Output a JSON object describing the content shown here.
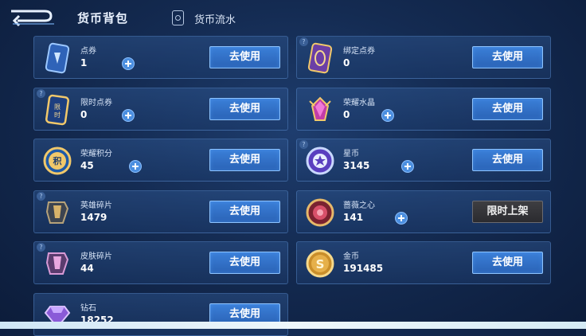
{
  "header": {
    "title": "货币背包",
    "flow_label": "货币流水",
    "back_icon": "back-arrow-icon",
    "flow_icon": "ledger-icon"
  },
  "action_label": "去使用",
  "limited_label": "限时上架",
  "items": [
    {
      "name": "点券",
      "count": "1",
      "icon": "coupon-icon",
      "help": false,
      "plus": true,
      "action": "use"
    },
    {
      "name": "绑定点券",
      "count": "0",
      "icon": "bound-coupon-icon",
      "help": true,
      "plus": false,
      "action": "use"
    },
    {
      "name": "限时点券",
      "count": "0",
      "icon": "limited-coupon-icon",
      "help": true,
      "plus": true,
      "action": "use"
    },
    {
      "name": "荣耀水晶",
      "count": "0",
      "icon": "glory-crystal-icon",
      "help": false,
      "plus": true,
      "action": "use"
    },
    {
      "name": "荣耀积分",
      "count": "45",
      "icon": "glory-points-icon",
      "help": false,
      "plus": true,
      "action": "use"
    },
    {
      "name": "星币",
      "count": "3145",
      "icon": "star-coin-icon",
      "help": true,
      "plus": true,
      "action": "use"
    },
    {
      "name": "英雄碎片",
      "count": "1479",
      "icon": "hero-fragment-icon",
      "help": true,
      "plus": false,
      "action": "use"
    },
    {
      "name": "蔷薇之心",
      "count": "141",
      "icon": "rose-heart-icon",
      "help": false,
      "plus": true,
      "action": "limited"
    },
    {
      "name": "皮肤碎片",
      "count": "44",
      "icon": "skin-fragment-icon",
      "help": true,
      "plus": false,
      "action": "use"
    },
    {
      "name": "金币",
      "count": "191485",
      "icon": "gold-coin-icon",
      "help": false,
      "plus": false,
      "action": "use"
    },
    {
      "name": "钻石",
      "count": "18252",
      "icon": "diamond-icon",
      "help": false,
      "plus": false,
      "action": "use"
    }
  ],
  "colors": {
    "use_button": "#2f6cc4",
    "limited_button": "#333338",
    "plus_button": "#4c8fe0",
    "background": "#142b52"
  }
}
